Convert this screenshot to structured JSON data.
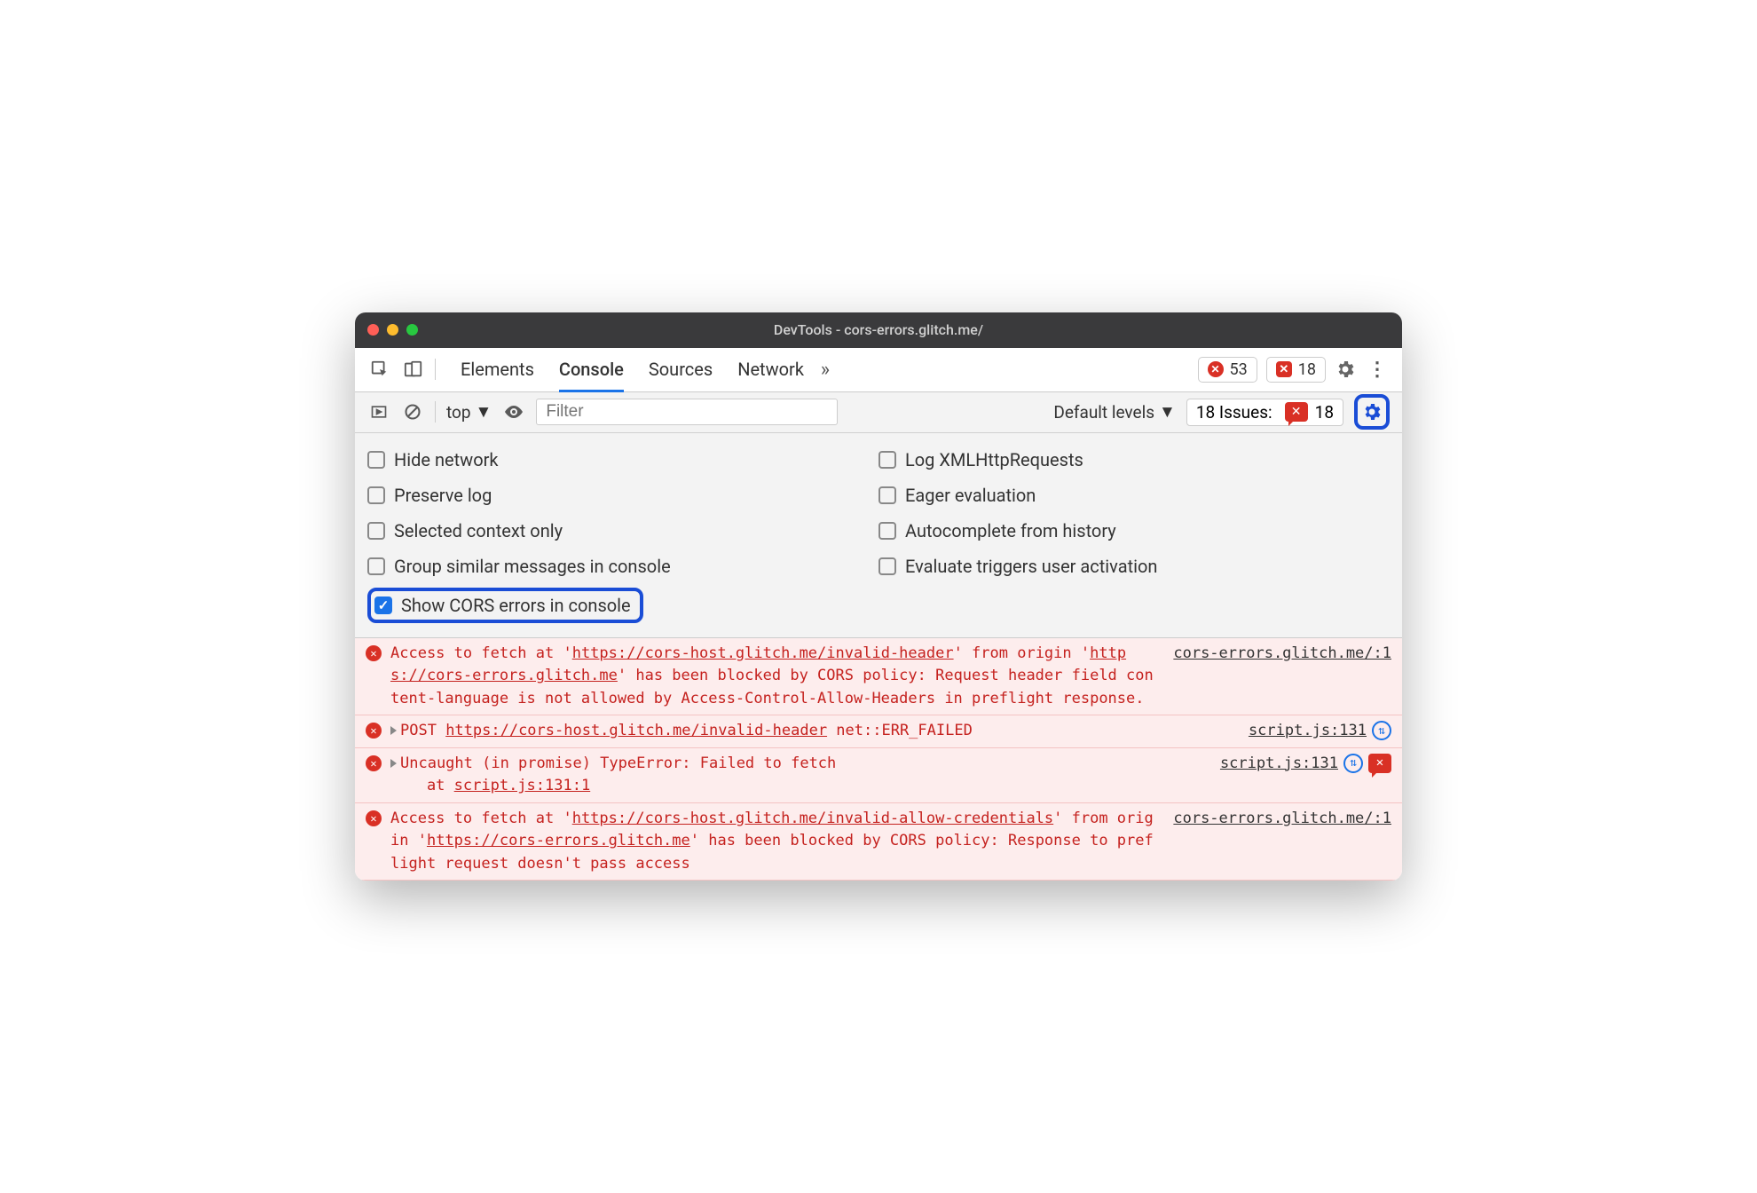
{
  "window": {
    "title": "DevTools - cors-errors.glitch.me/"
  },
  "tabs": {
    "items": [
      "Elements",
      "Console",
      "Sources",
      "Network"
    ],
    "active": 1
  },
  "counters": {
    "errors": "53",
    "issues": "18"
  },
  "filter": {
    "context": "top",
    "placeholder": "Filter",
    "levels": "Default levels",
    "issues_label": "18 Issues:",
    "issues_count": "18"
  },
  "settings": {
    "left": [
      {
        "label": "Hide network",
        "checked": false
      },
      {
        "label": "Preserve log",
        "checked": false
      },
      {
        "label": "Selected context only",
        "checked": false
      },
      {
        "label": "Group similar messages in console",
        "checked": false
      },
      {
        "label": "Show CORS errors in console",
        "checked": true,
        "highlight": true
      }
    ],
    "right": [
      {
        "label": "Log XMLHttpRequests",
        "checked": false
      },
      {
        "label": "Eager evaluation",
        "checked": false
      },
      {
        "label": "Autocomplete from history",
        "checked": false
      },
      {
        "label": "Evaluate triggers user activation",
        "checked": false
      }
    ]
  },
  "logs": [
    {
      "msg_html": "Access to fetch at '<span class=ul>https://cors-host.glitch.me/invalid-header</span>' from origin '<span class=ul>https://cors-errors.glitch.me</span>' has been blocked by CORS policy: Request header field content-language is not allowed by Access-Control-Allow-Headers in preflight response.",
      "src": "cors-errors.glitch.me/:1"
    },
    {
      "msg_html": "<span class=tri></span>POST <span class=ul>https://cors-host.glitch.me/invalid-header</span> net::ERR_FAILED",
      "src": "script.js:131",
      "net": true
    },
    {
      "msg_html": "<span class=tri></span>Uncaught (in promise) TypeError: Failed to fetch<br>&nbsp;&nbsp;&nbsp;&nbsp;at <span class=ul>script.js:131:1</span>",
      "src": "script.js:131",
      "net": true,
      "issue": true
    },
    {
      "msg_html": "Access to fetch at '<span class=ul>https://cors-host.glitch.me/invalid-allow-credentials</span>' from origin '<span class=ul>https://cors-errors.glitch.me</span>' has been blocked by CORS policy: Response to preflight request doesn't pass access",
      "src": "cors-errors.glitch.me/:1"
    }
  ]
}
